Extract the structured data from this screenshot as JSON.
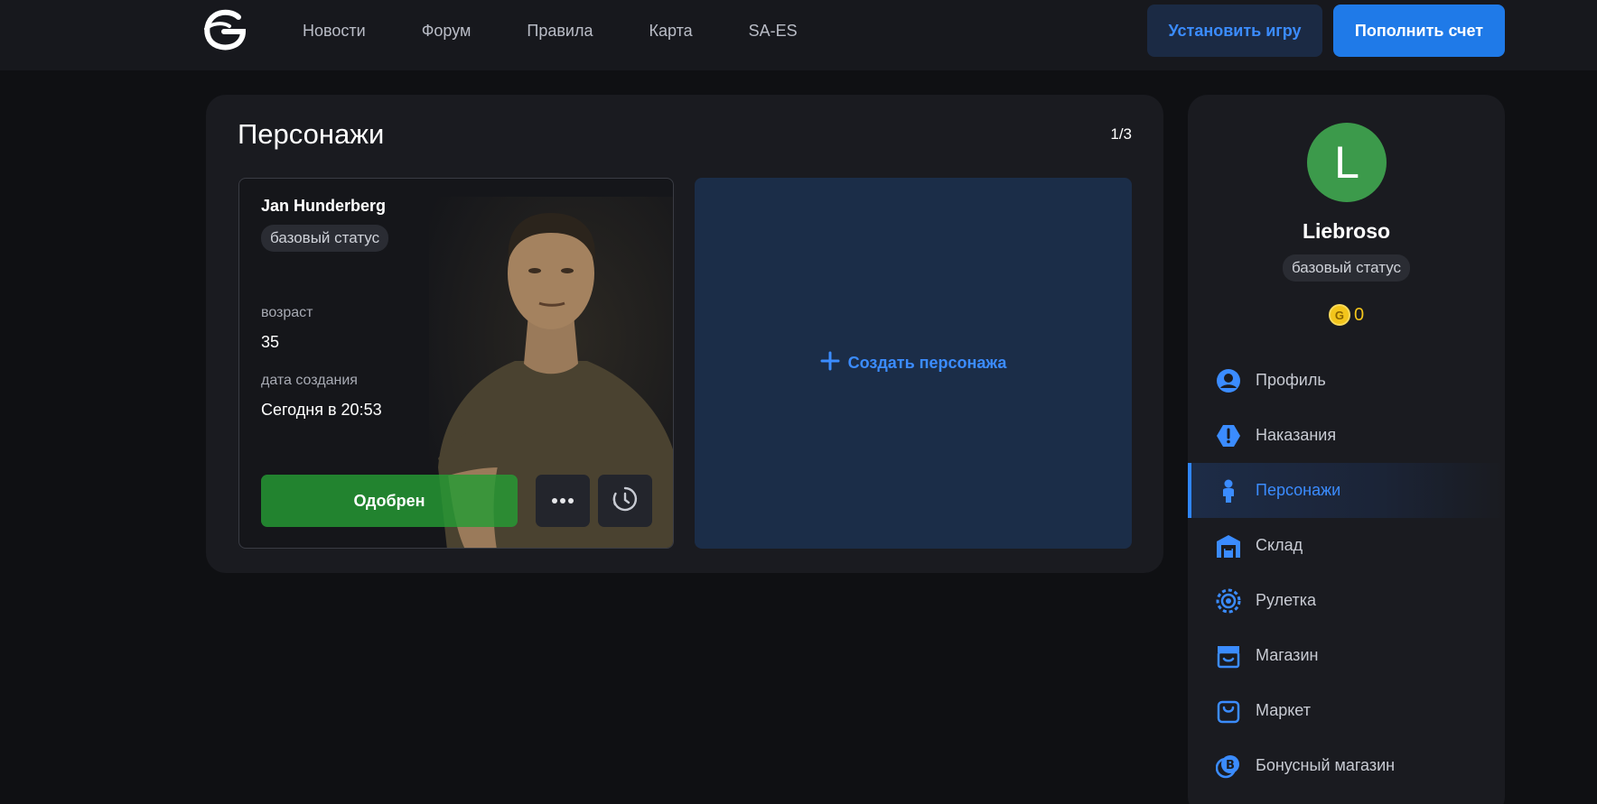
{
  "header": {
    "nav": [
      "Новости",
      "Форум",
      "Правила",
      "Карта",
      "SA-ES"
    ],
    "install_label": "Установить игру",
    "topup_label": "Пополнить счет"
  },
  "characters": {
    "title": "Персонажи",
    "counter": "1/3",
    "card": {
      "name": "Jan Hunderberg",
      "status": "базовый статус",
      "age_label": "возраст",
      "age": "35",
      "created_label": "дата создания",
      "created": "Сегодня в 20:53",
      "approved_label": "Одобрен"
    },
    "create_label": "Создать персонажа"
  },
  "sidebar": {
    "avatar_letter": "L",
    "username": "Liebroso",
    "status": "базовый статус",
    "coin_letter": "G",
    "balance": "0",
    "items": [
      {
        "label": "Профиль",
        "icon": "user-circle-icon"
      },
      {
        "label": "Наказания",
        "icon": "warning-hexagon-icon"
      },
      {
        "label": "Персонажи",
        "icon": "person-icon"
      },
      {
        "label": "Склад",
        "icon": "warehouse-icon"
      },
      {
        "label": "Рулетка",
        "icon": "roulette-icon"
      },
      {
        "label": "Магазин",
        "icon": "store-icon"
      },
      {
        "label": "Маркет",
        "icon": "shopping-bag-icon"
      },
      {
        "label": "Бонусный магазин",
        "icon": "bonus-coin-icon"
      }
    ]
  },
  "colors": {
    "accent": "#3b8cff",
    "approved": "#269b34",
    "avatar": "#3c9a4b",
    "coin": "#f3c51b"
  }
}
